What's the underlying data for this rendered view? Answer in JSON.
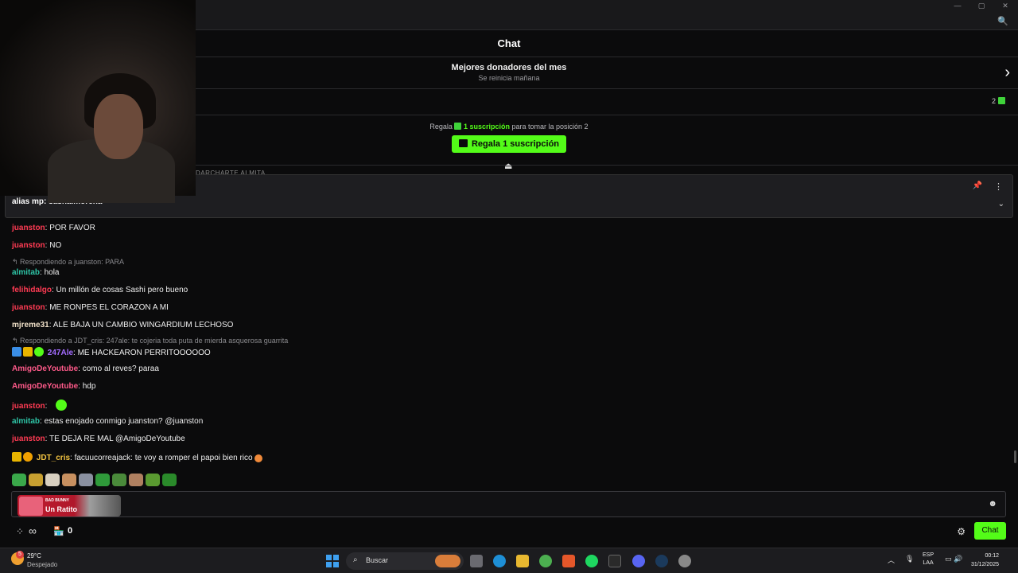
{
  "window": {
    "min": "—",
    "max": "▢",
    "close": "✕",
    "zoom_icon": "🔍"
  },
  "header": {
    "title": "Chat"
  },
  "donors": {
    "title": "Mejores donadores del mes",
    "subtitle": "Se reinicia mañana",
    "chevron": "›"
  },
  "rank_row": {
    "count": "2"
  },
  "gift": {
    "prefix": "Regala",
    "highlight": "1 suscripción",
    "suffix": "para tomar la posición 2",
    "button": "Regala 1 suscripción",
    "eject": "⏏"
  },
  "behind_text": "DARCHARTE ALMITA",
  "pinned": {
    "message": "alias mp: sasha.morena",
    "pin_icon": "📌",
    "more_icon": "⋮",
    "expand_icon": "⌄"
  },
  "colors": {
    "accent": "#53fc18",
    "red_user": "#ff3b53",
    "teal_user": "#2ec4a6",
    "yellow_user": "#f4c542",
    "purple_user": "#a36cff",
    "pink_user": "#ff5a8a"
  },
  "messages": [
    {
      "user": "juanston",
      "color": "#ff3b53",
      "text": ": POR FAVOR"
    },
    {
      "user": "juanston",
      "color": "#ff3b53",
      "text": ": NO"
    },
    {
      "reply": "↰ Respondiendo a juanston: PARA"
    },
    {
      "user": "almitab",
      "color": "#2ec4a6",
      "text": ": hola"
    },
    {
      "user": "felihidalgo",
      "color": "#ff3b53",
      "text": ": Un millón de cosas Sashi pero bueno"
    },
    {
      "user": "juanston",
      "color": "#ff3b53",
      "text": ": ME RONPES EL CORAZON A MI"
    },
    {
      "user": "mjreme31",
      "color": "#f0e0c8",
      "text": ": ALE BAJA UN CAMBIO WINGARDIUM LECHOSO"
    },
    {
      "reply": "↰ Respondiendo a JDT_cris: 247ale: te cojeria toda puta de mierda asquerosa guarrita"
    },
    {
      "user": "247Ale",
      "color": "#a36cff",
      "text": ": ME HACKEARON PERRITOOOOOO"
    },
    {
      "user": "AmigoDeYoutube",
      "color": "#ff5a8a",
      "text": ": como al reves? paraa"
    },
    {
      "user": "AmigoDeYoutube",
      "color": "#ff5a8a",
      "text": ": hdp"
    },
    {
      "user": "juanston",
      "color": "#ff3b53",
      "text": ":"
    },
    {
      "user": "almitab",
      "color": "#2ec4a6",
      "text": ": estas enojado conmigo juanston? @juanston"
    },
    {
      "user": "juanston",
      "color": "#ff3b53",
      "text": ": TE DEJA RE MAL @AmigoDeYoutube"
    },
    {
      "user": "JDT_cris",
      "color": "#f4c542",
      "text": ": facuucorreajack: te voy a romper el papoi bien rico"
    }
  ],
  "music": {
    "artist": "BAD BUNNY",
    "song": "Un Ratito"
  },
  "input": {
    "emoji_icon": "☻"
  },
  "bottom": {
    "dots": "⁘",
    "infinity": "∞",
    "store_icon": "🏪",
    "count": "0",
    "gear_icon": "⚙",
    "chat_button": "Chat"
  },
  "taskbar": {
    "weather_temp": "29°C",
    "weather_desc": "Despejado",
    "weather_badge": "5",
    "search_label": "Buscar",
    "lang_top": "ESP",
    "lang_bottom": "LAA",
    "time": "00:12",
    "date": "31/12/2025"
  }
}
